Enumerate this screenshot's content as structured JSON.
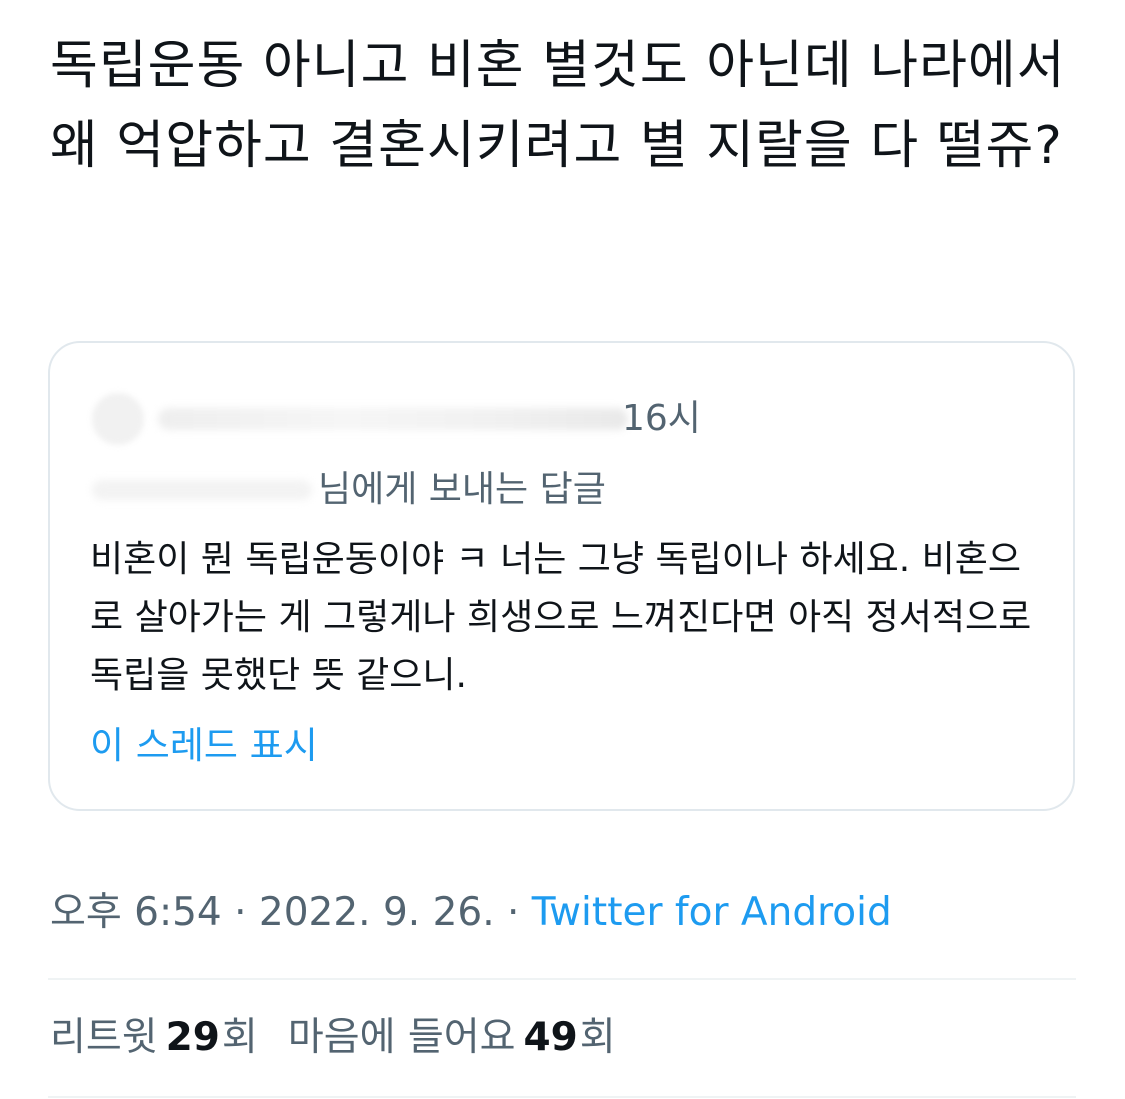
{
  "tweet": {
    "text": "독립운동 아니고 비혼 별것도 아닌데 나라에서 왜 억압하고 결혼시키려고 별 지랄을 다 떨쥬?"
  },
  "quoted_tweet": {
    "time": "16시",
    "reply_label": "님에게 보내는 답글",
    "body": "비혼이 뭔 독립운동이야 ㅋ 너는 그냥 독립이나 하세요. 비혼으로 살아가는 게 그렇게나 희생으로 느껴진다면 아직 정서적으로 독립을 못했단 뜻 같으니.",
    "show_thread": "이 스레드 표시"
  },
  "meta": {
    "timestamp": "오후 6:54 · 2022. 9. 26. · ",
    "source": "Twitter for Android"
  },
  "stats": {
    "retweets": {
      "label": "리트윗",
      "count": "29",
      "unit": "회"
    },
    "likes": {
      "label": "마음에 들어요",
      "count": "49",
      "unit": "회"
    }
  },
  "colors": {
    "text": "#0f1419",
    "secondary": "#536471",
    "link": "#1d9bf0",
    "border": "#e1e8ed"
  }
}
